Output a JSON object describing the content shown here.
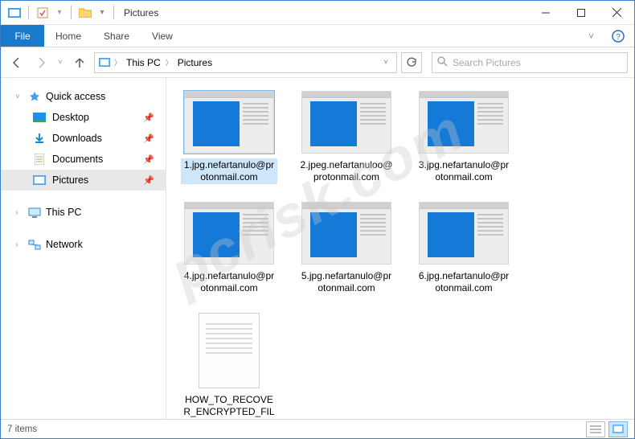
{
  "window": {
    "title": "Pictures"
  },
  "ribbon": {
    "file": "File",
    "tabs": [
      "Home",
      "Share",
      "View"
    ]
  },
  "breadcrumb": {
    "root_icon": "picture",
    "items": [
      "This PC",
      "Pictures"
    ]
  },
  "search": {
    "placeholder": "Search Pictures"
  },
  "sidebar": {
    "quick_access": {
      "label": "Quick access",
      "items": [
        {
          "label": "Desktop",
          "icon": "desktop",
          "pinned": true
        },
        {
          "label": "Downloads",
          "icon": "downloads",
          "pinned": true
        },
        {
          "label": "Documents",
          "icon": "documents",
          "pinned": true
        },
        {
          "label": "Pictures",
          "icon": "pictures",
          "pinned": true,
          "current": true
        }
      ]
    },
    "this_pc": {
      "label": "This PC"
    },
    "network": {
      "label": "Network"
    }
  },
  "files": [
    {
      "name": "1.jpg.nefartanulo@protonmail.com",
      "type": "image",
      "selected": true
    },
    {
      "name": "2.jpeg.nefartanuloo@protonmail.com",
      "type": "image"
    },
    {
      "name": "3.jpg.nefartanulo@protonmail.com",
      "type": "image"
    },
    {
      "name": "4.jpg.nefartanulo@protonmail.com",
      "type": "image"
    },
    {
      "name": "5.jpg.nefartanulo@protonmail.com",
      "type": "image"
    },
    {
      "name": "6.jpg.nefartanulo@protonmail.com",
      "type": "image"
    },
    {
      "name": "HOW_TO_RECOVER_ENCRYPTED_FILES.txt",
      "type": "text"
    }
  ],
  "status": {
    "count_label": "7 items"
  },
  "watermark": "pcrisk.com"
}
